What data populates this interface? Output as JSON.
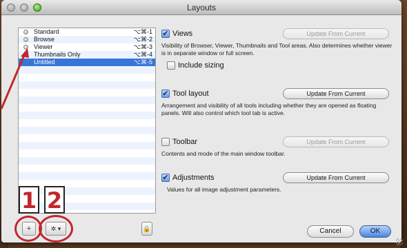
{
  "window": {
    "title": "Layouts"
  },
  "layouts": [
    {
      "name": "Standard",
      "shortcut": "⌥⌘-1",
      "selected": false
    },
    {
      "name": "Browse",
      "shortcut": "⌥⌘-2",
      "selected": false
    },
    {
      "name": "Viewer",
      "shortcut": "⌥⌘-3",
      "selected": false
    },
    {
      "name": "Thumbnails Only",
      "shortcut": "⌥⌘-4",
      "selected": false
    },
    {
      "name": "Untitled",
      "shortcut": "⌥⌘-5",
      "selected": true
    }
  ],
  "list_buttons": {
    "add": "+",
    "gear": "✲ ▾",
    "lock": "🔒"
  },
  "annotations": {
    "one": "1",
    "two": "2"
  },
  "sections": {
    "views": {
      "label": "Views",
      "checked": true,
      "button": "Update From Current",
      "button_enabled": false,
      "description": "Visibility of Browser, Viewer, Thumbnails and Tool areas. Also determines whether viewer is in separate window or full screen.",
      "sub": {
        "label": "Include sizing",
        "checked": false
      }
    },
    "tool_layout": {
      "label": "Tool layout",
      "checked": true,
      "button": "Update From Current",
      "button_enabled": true,
      "description": "Arrangement and visibility of all tools including whether they are opened as floating panels. Will also control which tool tab is active."
    },
    "toolbar": {
      "label": "Toolbar",
      "checked": false,
      "button": "Update From Current",
      "button_enabled": false,
      "description": "Contents and mode of the main window toolbar."
    },
    "adjustments": {
      "label": "Adjustments",
      "checked": true,
      "button": "Update From Current",
      "button_enabled": true,
      "description": "Values for all image adjustment parameters."
    }
  },
  "footer": {
    "cancel": "Cancel",
    "ok": "OK"
  },
  "colors": {
    "selection": "#3875d7",
    "annotation_red": "#c1272d"
  }
}
